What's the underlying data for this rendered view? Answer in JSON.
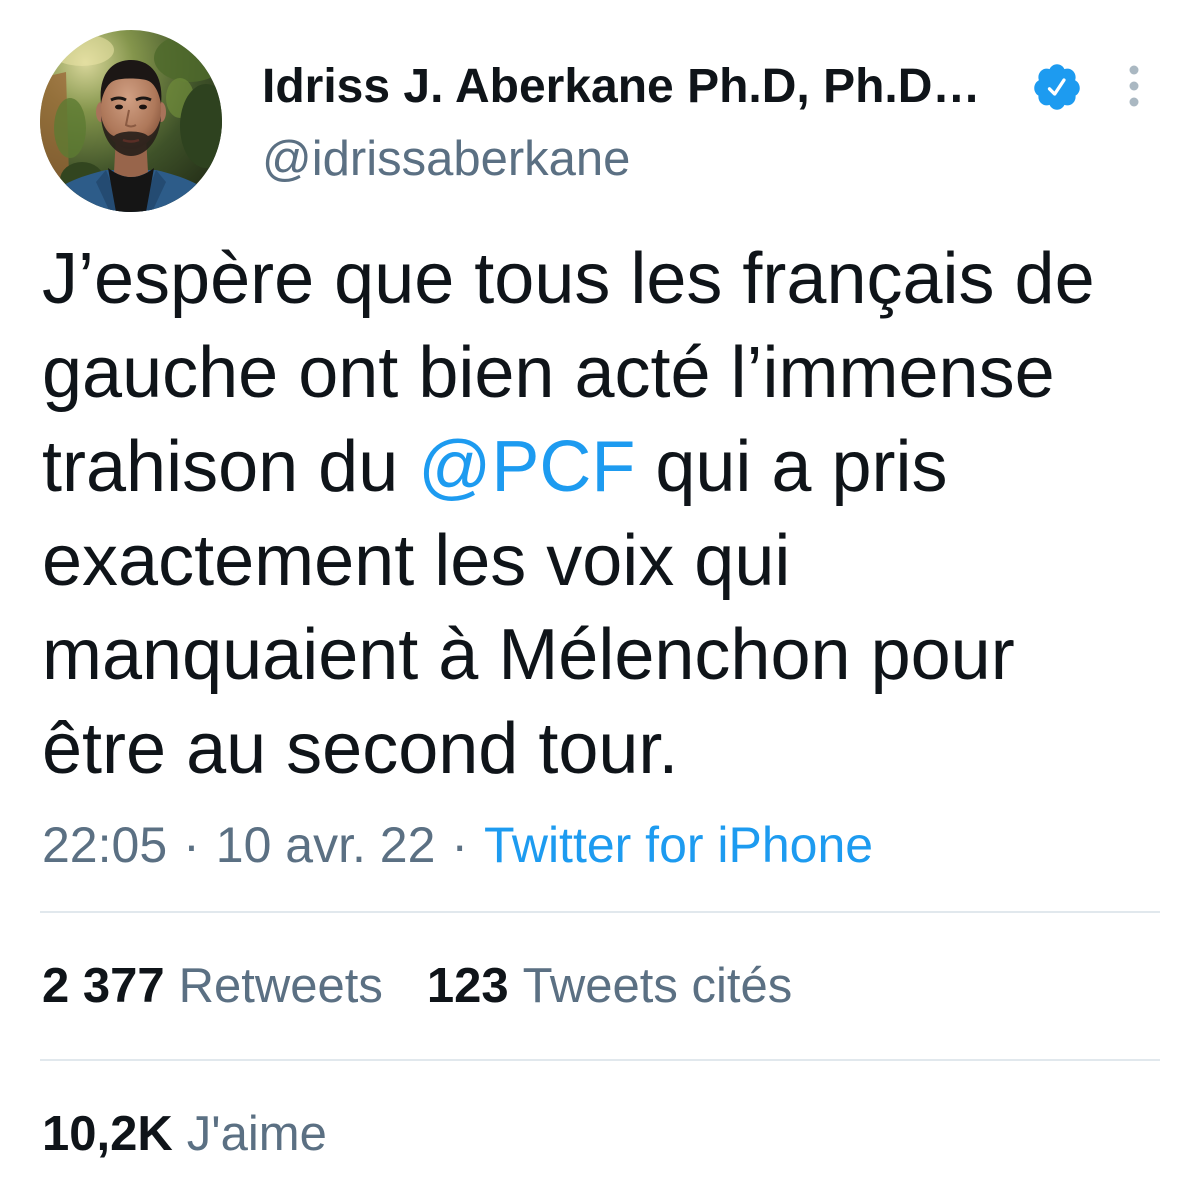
{
  "tweet": {
    "author": {
      "display_name": "Idriss J. Aberkane Ph.D, Ph.D…",
      "handle": "@idrissaberkane"
    },
    "body": {
      "text_before_mention": "J’espère que tous les français de gauche ont bien acté l’immense trahison du ",
      "mention": "@PCF",
      "text_after_mention": " qui a pris exactement les voix qui manquaient à Mélenchon pour être au second tour."
    },
    "meta": {
      "time": "22:05",
      "separator": "·",
      "date": "10 avr. 22",
      "source": "Twitter for iPhone"
    },
    "stats": {
      "retweets": {
        "count": "2 377",
        "label": "Retweets"
      },
      "quote_tweets": {
        "count": "123",
        "label": "Tweets cités"
      },
      "likes": {
        "count": "10,2K",
        "label": "J'aime"
      }
    }
  },
  "icons": {
    "avatar": "avatar-photo",
    "verified": "verified-badge-icon",
    "more": "more-vertical-icon"
  },
  "colors": {
    "background": "#ffffff",
    "text_primary": "#0f1419",
    "text_secondary": "#5b7083",
    "link": "#1d9bf0",
    "verified": "#1d9bf0",
    "icon_muted": "#aab8c2",
    "divider": "#e1e8ed"
  }
}
